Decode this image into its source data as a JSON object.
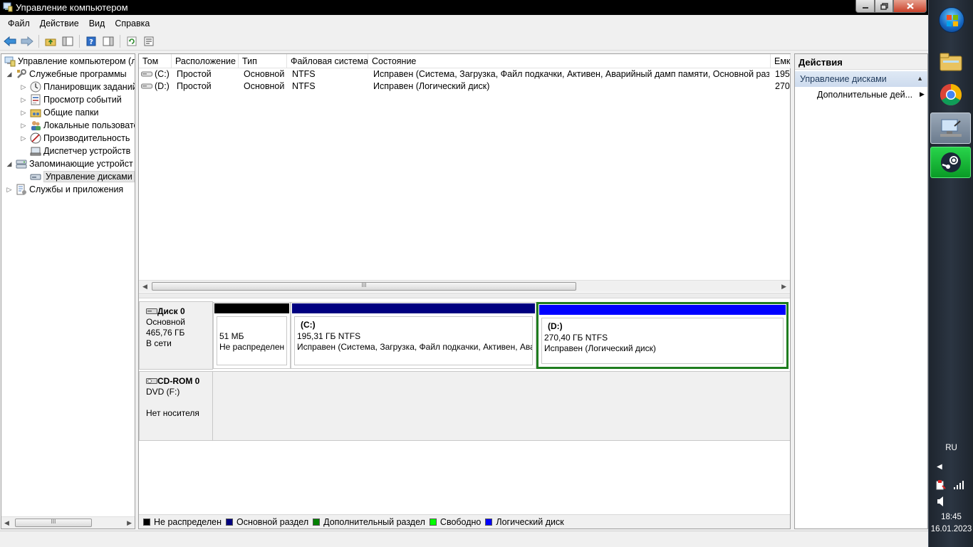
{
  "window": {
    "title": "Управление компьютером"
  },
  "menu": [
    "Файл",
    "Действие",
    "Вид",
    "Справка"
  ],
  "tree": {
    "items": [
      {
        "label": "Управление компьютером (л",
        "level": 0,
        "expander": "",
        "icon": "computer-management-icon"
      },
      {
        "label": "Служебные программы",
        "level": 1,
        "expander": "◢",
        "icon": "tools-icon"
      },
      {
        "label": "Планировщик заданий",
        "level": 2,
        "expander": "▷",
        "icon": "clock-icon"
      },
      {
        "label": "Просмотр событий",
        "level": 2,
        "expander": "▷",
        "icon": "event-viewer-icon"
      },
      {
        "label": "Общие папки",
        "level": 2,
        "expander": "▷",
        "icon": "shared-folders-icon"
      },
      {
        "label": "Локальные пользовате",
        "level": 2,
        "expander": "▷",
        "icon": "users-icon"
      },
      {
        "label": "Производительность",
        "level": 2,
        "expander": "▷",
        "icon": "performance-icon"
      },
      {
        "label": "Диспетчер устройств",
        "level": 2,
        "expander": "",
        "icon": "device-manager-icon"
      },
      {
        "label": "Запоминающие устройст",
        "level": 1,
        "expander": "◢",
        "icon": "storage-icon"
      },
      {
        "label": "Управление дисками",
        "level": 2,
        "expander": "",
        "icon": "disk-management-icon",
        "selected": true
      },
      {
        "label": "Службы и приложения",
        "level": 1,
        "expander": "▷",
        "icon": "services-icon"
      }
    ]
  },
  "volumes": {
    "columns": [
      "Том",
      "Расположение",
      "Тип",
      "Файловая система",
      "Состояние",
      "Емк"
    ],
    "rows": [
      {
        "volume": "(C:)",
        "layout": "Простой",
        "type": "Основной",
        "fs": "NTFS",
        "status": "Исправен (Система, Загрузка, Файл подкачки, Активен, Аварийный дамп памяти, Основной раздел)",
        "capacity": "195,"
      },
      {
        "volume": "(D:)",
        "layout": "Простой",
        "type": "Основной",
        "fs": "NTFS",
        "status": "Исправен (Логический диск)",
        "capacity": "270,"
      }
    ]
  },
  "disk0": {
    "name": "Диск 0",
    "type": "Основной",
    "size": "465,76 ГБ",
    "state": "В сети",
    "partitions": [
      {
        "name": "",
        "size": "51 МБ",
        "status": "Не распределен",
        "color": "#000000"
      },
      {
        "name": "(C:)",
        "size": "195,31 ГБ NTFS",
        "status": "Исправен (Система, Загрузка, Файл подкачки, Активен, Ава",
        "color": "#000080"
      },
      {
        "name": "(D:)",
        "size": "270,40 ГБ NTFS",
        "status": "Исправен (Логический диск)",
        "color": "#0000ff"
      }
    ]
  },
  "cdrom0": {
    "name": "CD-ROM 0",
    "drive": "DVD (F:)",
    "state": "Нет носителя"
  },
  "legend": [
    {
      "label": "Не распределен",
      "color": "#000000"
    },
    {
      "label": "Основной раздел",
      "color": "#000080"
    },
    {
      "label": "Дополнительный раздел",
      "color": "#008000"
    },
    {
      "label": "Свободно",
      "color": "#00ff00"
    },
    {
      "label": "Логический диск",
      "color": "#0000ff"
    }
  ],
  "actions": {
    "title": "Действия",
    "section": "Управление дисками",
    "item": "Дополнительные дей..."
  },
  "taskbar": {
    "lang": "RU",
    "time": "18:45",
    "date": "16.01.2023"
  }
}
